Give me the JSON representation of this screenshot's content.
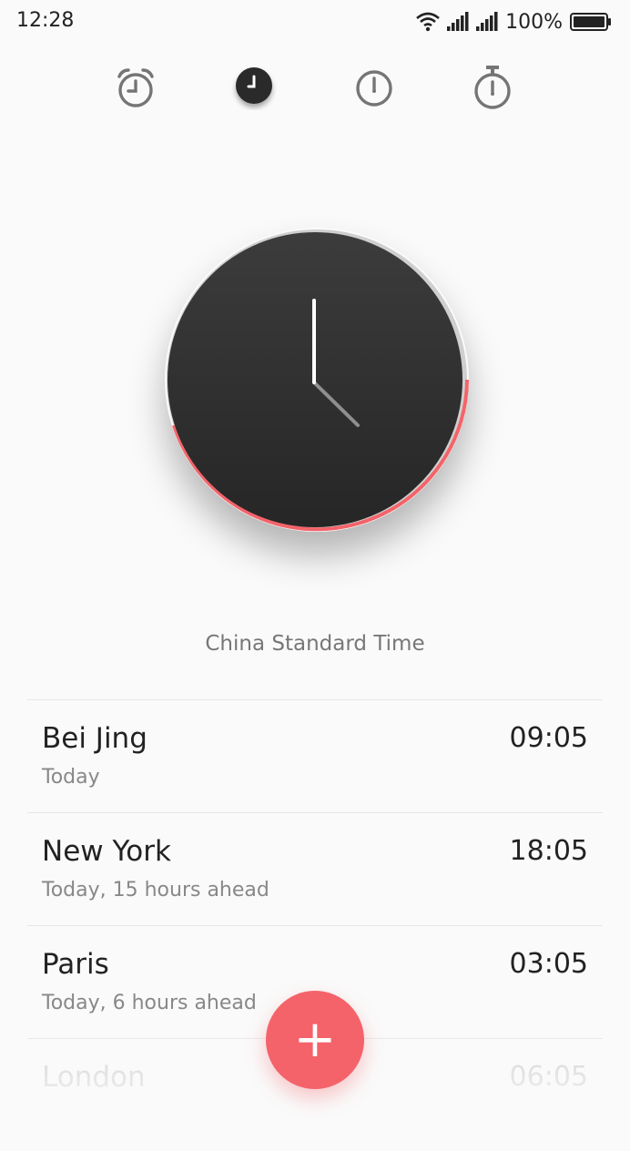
{
  "status_bar": {
    "time": "12:28",
    "battery_percent": "100%",
    "icons": [
      "wifi-icon",
      "signal-icon",
      "signal-icon",
      "battery-icon"
    ]
  },
  "tabs": [
    {
      "id": "alarm",
      "icon": "alarm-clock-icon",
      "active": false
    },
    {
      "id": "world-clock",
      "icon": "clock-icon",
      "active": true
    },
    {
      "id": "timer",
      "icon": "timer-icon",
      "active": false
    },
    {
      "id": "stopwatch",
      "icon": "stopwatch-icon",
      "active": false
    }
  ],
  "clock": {
    "timezone": "China Standard Time",
    "face_color": "#2f2f2f",
    "accent_color": "#f4636a"
  },
  "cities": [
    {
      "name": "Bei Jing",
      "sub": "Today",
      "time": "09:05"
    },
    {
      "name": "New York",
      "sub": "Today, 15 hours ahead",
      "time": "18:05"
    },
    {
      "name": "Paris",
      "sub": "Today, 6 hours ahead",
      "time": "03:05"
    },
    {
      "name": "London",
      "sub": "",
      "time": "06:05"
    }
  ],
  "fab": {
    "label": "+",
    "icon": "plus-icon"
  }
}
